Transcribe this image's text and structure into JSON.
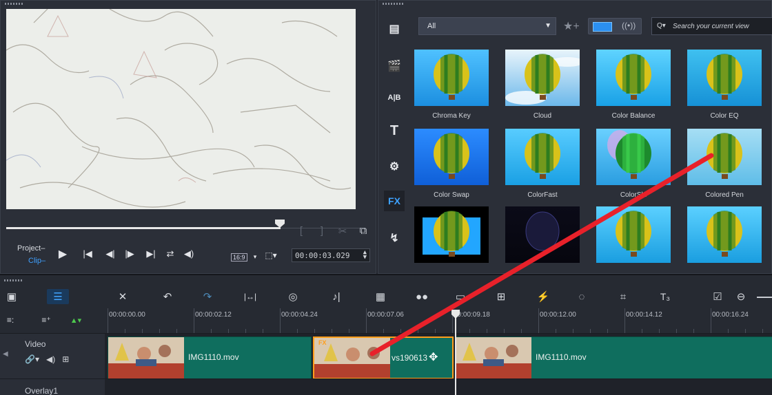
{
  "player": {
    "project_label": "Project–",
    "clip_label": "Clip–",
    "ratio_label": "16:9",
    "timecode": "00:00:03.029",
    "mark_in": "[",
    "mark_out": "]"
  },
  "library": {
    "category": "All",
    "search_placeholder": "Search your current view",
    "fx_label": "FX",
    "effects": [
      {
        "label": "Chroma Key"
      },
      {
        "label": "Cloud"
      },
      {
        "label": "Color Balance"
      },
      {
        "label": "Color EQ"
      },
      {
        "label": "Color Swap"
      },
      {
        "label": "ColorFast"
      },
      {
        "label": "ColorShi"
      },
      {
        "label": "Colored Pen"
      },
      {
        "label": ""
      },
      {
        "label": ""
      },
      {
        "label": ""
      },
      {
        "label": ""
      }
    ]
  },
  "timeline": {
    "ruler": [
      "00:00:00.00",
      "00:00:02.12",
      "00:00:04.24",
      "00:00:07.06",
      "00:00:09.18",
      "00:00:12.00",
      "00:00:14.12",
      "00:00:16.24"
    ],
    "tracks": [
      {
        "name": "Video"
      },
      {
        "name": "Overlay1"
      }
    ],
    "clips": [
      {
        "label": "IMG1110.mov",
        "fx": ""
      },
      {
        "label": "vs190613",
        "fx": "FX"
      },
      {
        "label": "IMG1110.mov",
        "fx": ""
      }
    ]
  },
  "colors": {
    "accent": "#3da2ff",
    "clip_green": "#0f6e5e",
    "selection": "#ff9e1b",
    "annotation_arrow": "#e8212a"
  }
}
